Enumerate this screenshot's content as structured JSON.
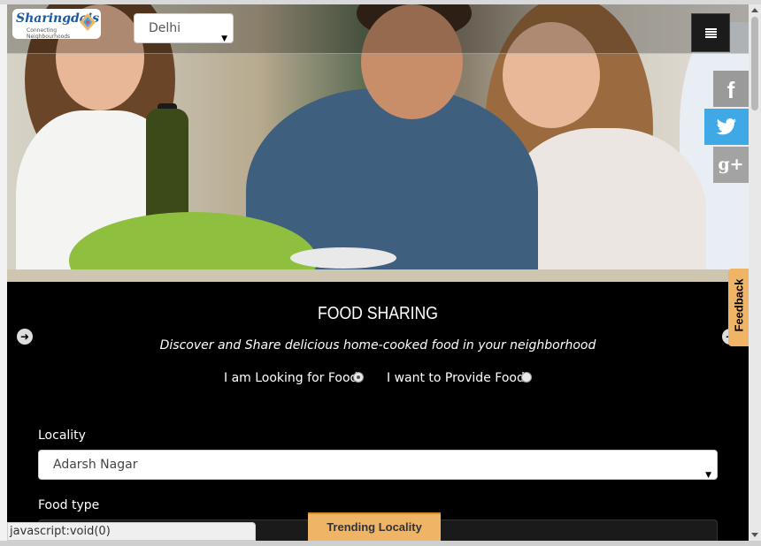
{
  "header": {
    "logo_text": "Sharingdais",
    "logo_tagline": "Connecting Neighbourhoods",
    "city_selected": "Delhi"
  },
  "social": {
    "facebook_glyph": "f",
    "googleplus_glyph": "g+"
  },
  "hero": {
    "title": "FOOD SHARING",
    "subtitle": "Discover and Share delicious home-cooked food in your neighborhood"
  },
  "mode_options": [
    {
      "label": "I am Looking for Food",
      "selected": true
    },
    {
      "label": "I want to Provide Food",
      "selected": false
    }
  ],
  "form": {
    "locality_label": "Locality",
    "locality_value": "Adarsh Nagar",
    "food_type_label": "Food type",
    "food_type_value": ""
  },
  "tabs": {
    "feedback": "Feedback",
    "trending": "Trending Locality"
  },
  "status_bar": "javascript:void(0)",
  "colors": {
    "accent_orange": "#f0b466",
    "twitter_blue": "#3fa9e8",
    "content_bg": "#000000"
  },
  "icons": [
    "menu-icon",
    "facebook-icon",
    "twitter-icon",
    "googleplus-icon",
    "arrow-left-icon",
    "arrow-right-icon",
    "dropdown-arrow-icon"
  ]
}
